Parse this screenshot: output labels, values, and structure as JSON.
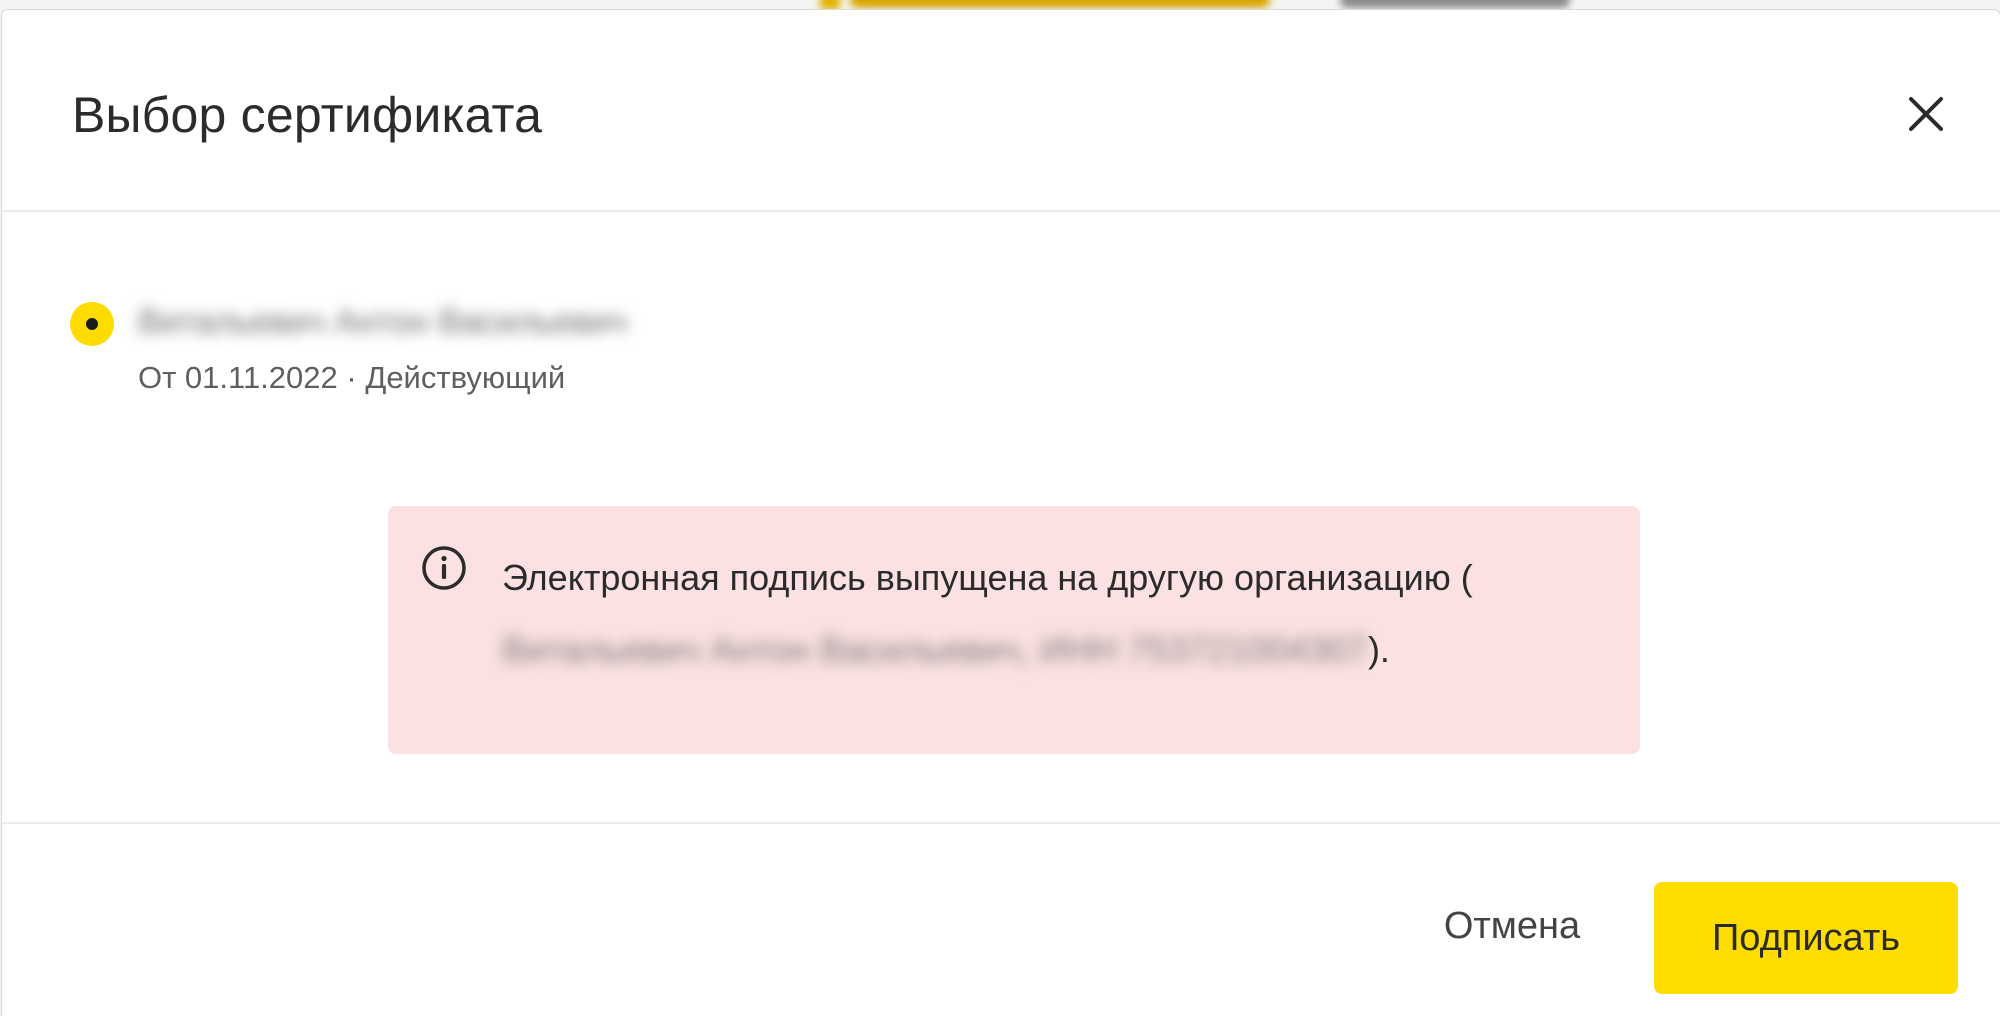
{
  "dialog": {
    "title": "Выбор сертификата",
    "close_icon": "close-icon"
  },
  "certificate": {
    "selected": true,
    "owner_name": "Витальевич Антон Васильевич",
    "meta": "От 01.11.2022 · Действующий"
  },
  "alert": {
    "icon": "info-circle-icon",
    "text_before": "Электронная подпись выпущена на другую организацию (",
    "redacted": "Витальевич Антон Васильевич, ИНН 753721004307",
    "text_after": ")."
  },
  "footer": {
    "cancel_label": "Отмена",
    "sign_label": "Подписать"
  },
  "colors": {
    "accent_yellow": "#ffdd00",
    "alert_bg": "#fbe1e1",
    "text_primary": "#2b2b2b",
    "text_secondary": "#5f5f5f"
  }
}
